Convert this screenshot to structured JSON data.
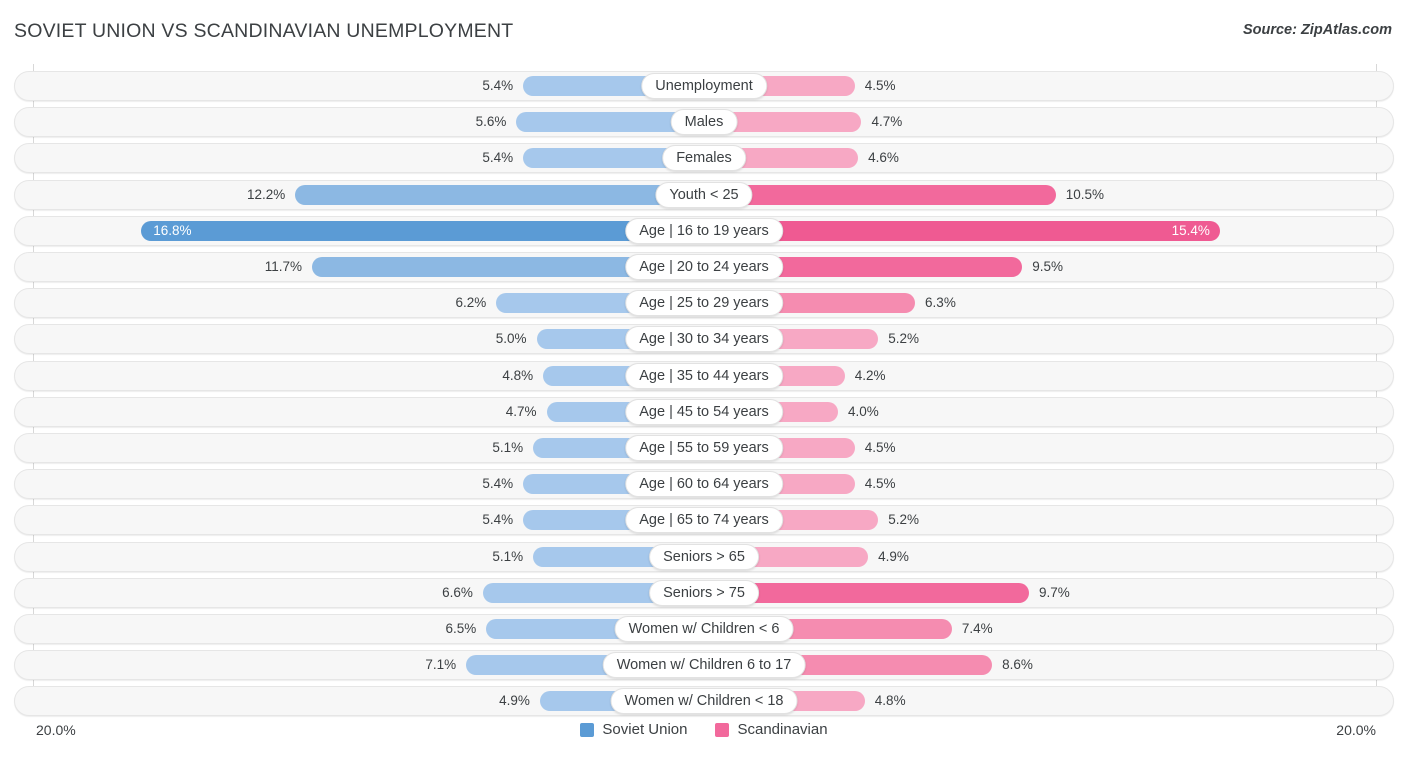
{
  "header": {
    "title": "SOVIET UNION VS SCANDINAVIAN UNEMPLOYMENT",
    "source": "Source: ZipAtlas.com"
  },
  "footer": {
    "axis_min_left": "20.0%",
    "axis_min_right": "20.0%",
    "legend": [
      {
        "label": "Soviet Union",
        "color": "#5b9bd5"
      },
      {
        "label": "Scandinavian",
        "color": "#f2699c"
      }
    ]
  },
  "colors": {
    "left_light": "#a6c8ec",
    "left_mid": "#8cb8e3",
    "left_dark": "#5b9bd5",
    "right_light": "#f7a8c4",
    "right_mid": "#f58cb0",
    "right_dark": "#f2699c",
    "right_darkest": "#ef5a92",
    "track": "#f7f7f7",
    "track_border": "#e6e6e6"
  },
  "chart_data": {
    "type": "bar",
    "subtype": "diverging-bar",
    "title": "SOVIET UNION VS SCANDINAVIAN UNEMPLOYMENT",
    "xlabel": "",
    "ylabel": "",
    "axis_max": 20.0,
    "axis_unit": "%",
    "grid": false,
    "legend_position": "bottom-center",
    "categories": [
      "Unemployment",
      "Males",
      "Females",
      "Youth < 25",
      "Age | 16 to 19 years",
      "Age | 20 to 24 years",
      "Age | 25 to 29 years",
      "Age | 30 to 34 years",
      "Age | 35 to 44 years",
      "Age | 45 to 54 years",
      "Age | 55 to 59 years",
      "Age | 60 to 64 years",
      "Age | 65 to 74 years",
      "Seniors > 65",
      "Seniors > 75",
      "Women w/ Children < 6",
      "Women w/ Children 6 to 17",
      "Women w/ Children < 18"
    ],
    "series": [
      {
        "name": "Soviet Union",
        "side": "left",
        "color": "#5b9bd5",
        "values": [
          5.4,
          5.6,
          5.4,
          12.2,
          16.8,
          11.7,
          6.2,
          5.0,
          4.8,
          4.7,
          5.1,
          5.4,
          5.4,
          5.1,
          6.6,
          6.5,
          7.1,
          4.9
        ],
        "labels": [
          "5.4%",
          "5.6%",
          "5.4%",
          "12.2%",
          "16.8%",
          "11.7%",
          "6.2%",
          "5.0%",
          "4.8%",
          "4.7%",
          "5.1%",
          "5.4%",
          "5.4%",
          "5.1%",
          "6.6%",
          "6.5%",
          "7.1%",
          "4.9%"
        ]
      },
      {
        "name": "Scandinavian",
        "side": "right",
        "color": "#f2699c",
        "values": [
          4.5,
          4.7,
          4.6,
          10.5,
          15.4,
          9.5,
          6.3,
          5.2,
          4.2,
          4.0,
          4.5,
          4.5,
          5.2,
          4.9,
          9.7,
          7.4,
          8.6,
          4.8
        ],
        "labels": [
          "4.5%",
          "4.7%",
          "4.6%",
          "10.5%",
          "15.4%",
          "9.5%",
          "6.3%",
          "5.2%",
          "4.2%",
          "4.0%",
          "4.5%",
          "4.5%",
          "5.2%",
          "4.9%",
          "9.7%",
          "7.4%",
          "8.6%",
          "4.8%"
        ]
      }
    ]
  }
}
